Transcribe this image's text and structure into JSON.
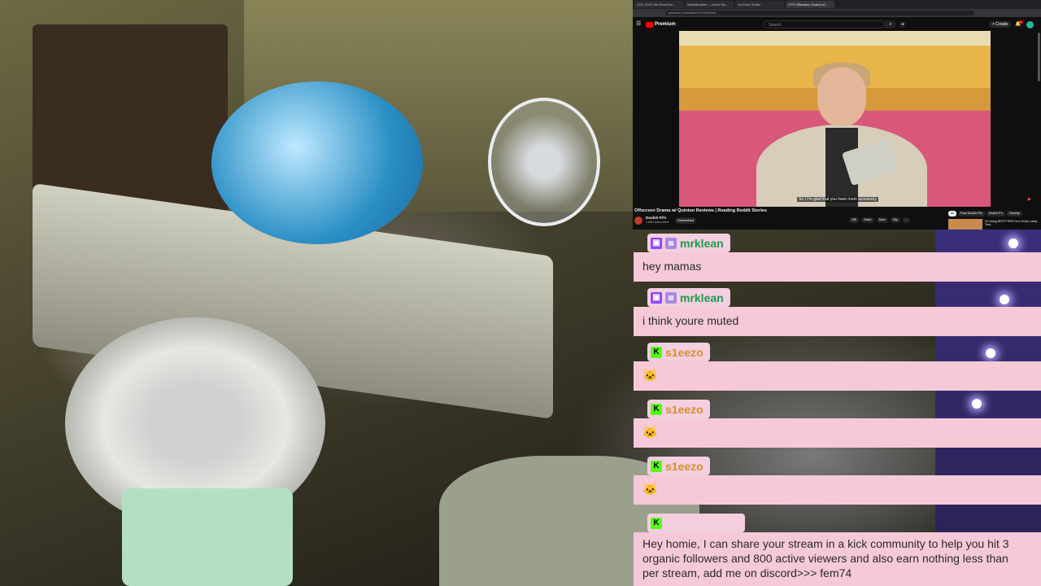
{
  "browser": {
    "tabs": [
      "2021 2022 Life Reset Au...",
      "Walletbooklet — Good Sto...",
      "YouTube Studio",
      "OTS Offseason Drama w/..."
    ],
    "url": "youtube.com/watch?v=FRa0Hn0...",
    "youtube": {
      "logo_text": "Premium",
      "search_placeholder": "Search",
      "create_label": "+ Create",
      "notification_count": "9+",
      "caption": "So I I'm glad that you have room accessory",
      "video_title": "Offscreen Drama w/ Quinton Reviews | Reading Reddit Stories",
      "channel_name": "Doolch Fil's",
      "channel_subs": "1.89M subscribers",
      "subscribe_label": "Subscribed",
      "actions": [
        "19K",
        "Share",
        "Save",
        "Clip",
        "..."
      ],
      "chips": [
        "All",
        "From Doolch Fil's",
        "Doolch P's",
        "Comedy"
      ],
      "rec_title": "I'm Going BROTTHER On A Goofy Lately Tour..."
    }
  },
  "chat": {
    "messages": [
      {
        "username": "mrklean",
        "color": "#1e9a4b",
        "platform": "twitch",
        "text": "hey mamas"
      },
      {
        "username": "mrklean",
        "color": "#1e9a4b",
        "platform": "twitch",
        "text": "i think youre muted"
      },
      {
        "username": "s1eezo",
        "color": "#d9902a",
        "platform": "kick",
        "text": "emote"
      },
      {
        "username": "s1eezo",
        "color": "#d9902a",
        "platform": "kick",
        "text": "emote"
      },
      {
        "username": "s1eezo",
        "color": "#d9902a",
        "platform": "kick",
        "text": "emote"
      },
      {
        "username": "",
        "color": "#e8e0e0",
        "platform": "kick",
        "text": "Hey homie, I can share your stream in a kick community to help you hit 3 organic followers and 800 active viewers and also earn nothing less than per stream, add me on discord>>> fem74"
      }
    ],
    "emote_glyph": "🐱",
    "spam_lines": [
      "Hey homie, I can share your stream in a kick community to help you hit 3",
      "organic followers and 800 active viewers and also earn nothing less than",
      "per stream, add me on discord>>> fem74"
    ]
  },
  "colors": {
    "chat_bubble": "#f6c9d8",
    "name_tag": "#f4cfe0",
    "twitch": "#9146ff",
    "kick": "#53fc18"
  }
}
